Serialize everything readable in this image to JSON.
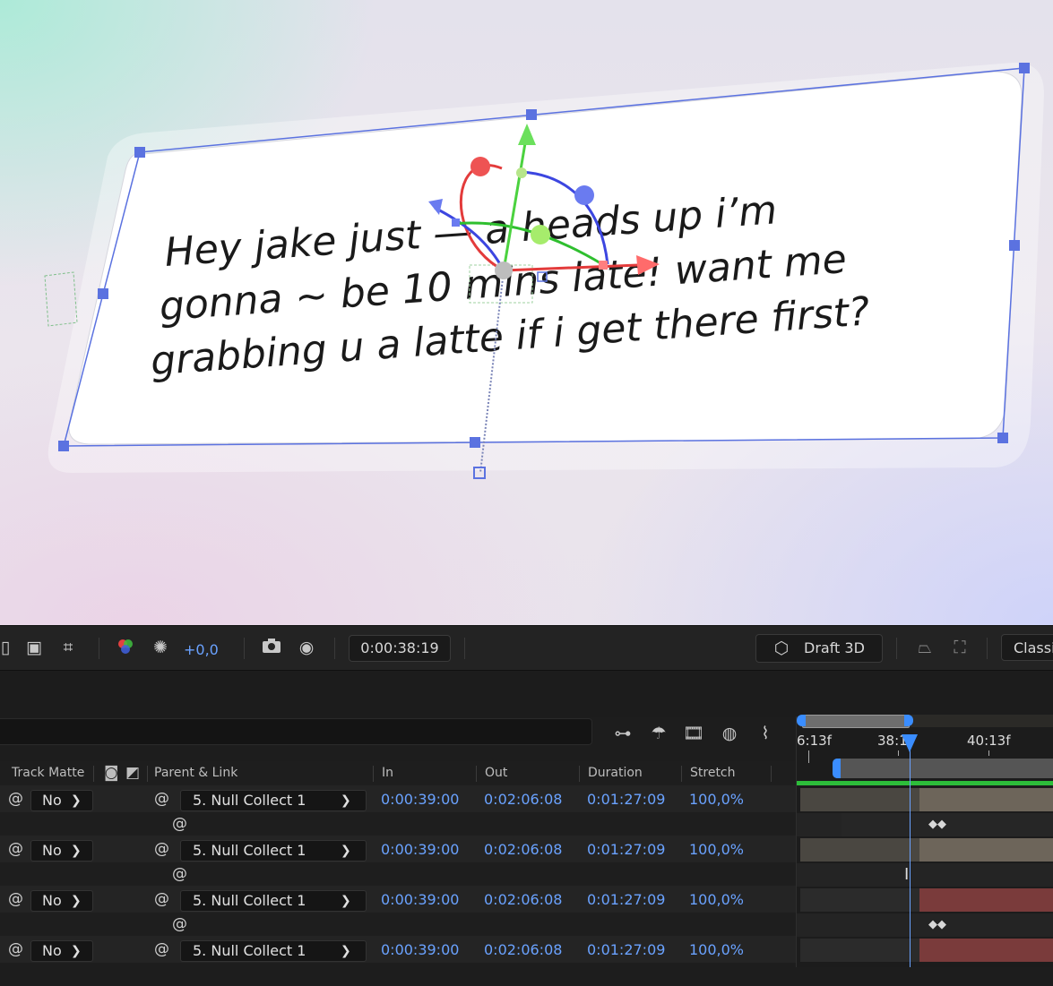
{
  "composition": {
    "text_lines": [
      "Hey jake just — a heads up i’m",
      "gonna ~ be 10 mins late! want me",
      "grabbing u a latte if i get there first?"
    ]
  },
  "toolbar": {
    "exposure": "+0,0",
    "timecode": "0:00:38:19",
    "renderer": "Draft 3D",
    "mode": "Classi",
    "icons": [
      "region-of-interest-icon",
      "transparency-grid-icon",
      "guides-icon",
      "color-channels-icon",
      "exposure-icon",
      "snapshot-camera-icon",
      "show-snapshot-icon",
      "draft-3d-icon",
      "3d-ground-plane-icon",
      "extended-viewer-icon"
    ]
  },
  "timeline": {
    "columns": {
      "track_matte": "Track Matte",
      "parent_link": "Parent & Link",
      "in": "In",
      "out": "Out",
      "duration": "Duration",
      "stretch": "Stretch"
    },
    "ruler": {
      "left": "6:13f",
      "current": "38:1",
      "right": "40:13f"
    },
    "layers": [
      {
        "matte": "No",
        "parent": "5. Null Collect 1",
        "in": "0:00:39:00",
        "out": "0:02:06:08",
        "duration": "0:01:27:09",
        "stretch": "100,0%",
        "track_color": "#6d655a",
        "keyframes": "◆◆"
      },
      {
        "matte": "No",
        "parent": "5. Null Collect 1",
        "in": "0:00:39:00",
        "out": "0:02:06:08",
        "duration": "0:01:27:09",
        "stretch": "100,0%",
        "track_color": "#6d655a",
        "keyframes": ""
      },
      {
        "matte": "No",
        "parent": "5. Null Collect 1",
        "in": "0:00:39:00",
        "out": "0:02:06:08",
        "duration": "0:01:27:09",
        "stretch": "100,0%",
        "track_color": "#7a3b3b",
        "keyframes": "◆◆"
      },
      {
        "matte": "No",
        "parent": "5. Null Collect 1",
        "in": "0:00:39:00",
        "out": "0:02:06:08",
        "duration": "0:01:27:09",
        "stretch": "100,0%",
        "track_color": "#7a3b3b",
        "keyframes": ""
      }
    ]
  },
  "colors": {
    "accent_blue": "#6aa2ff",
    "work_area_green": "#2dbd3a",
    "handle_blue": "#5b72e0"
  }
}
